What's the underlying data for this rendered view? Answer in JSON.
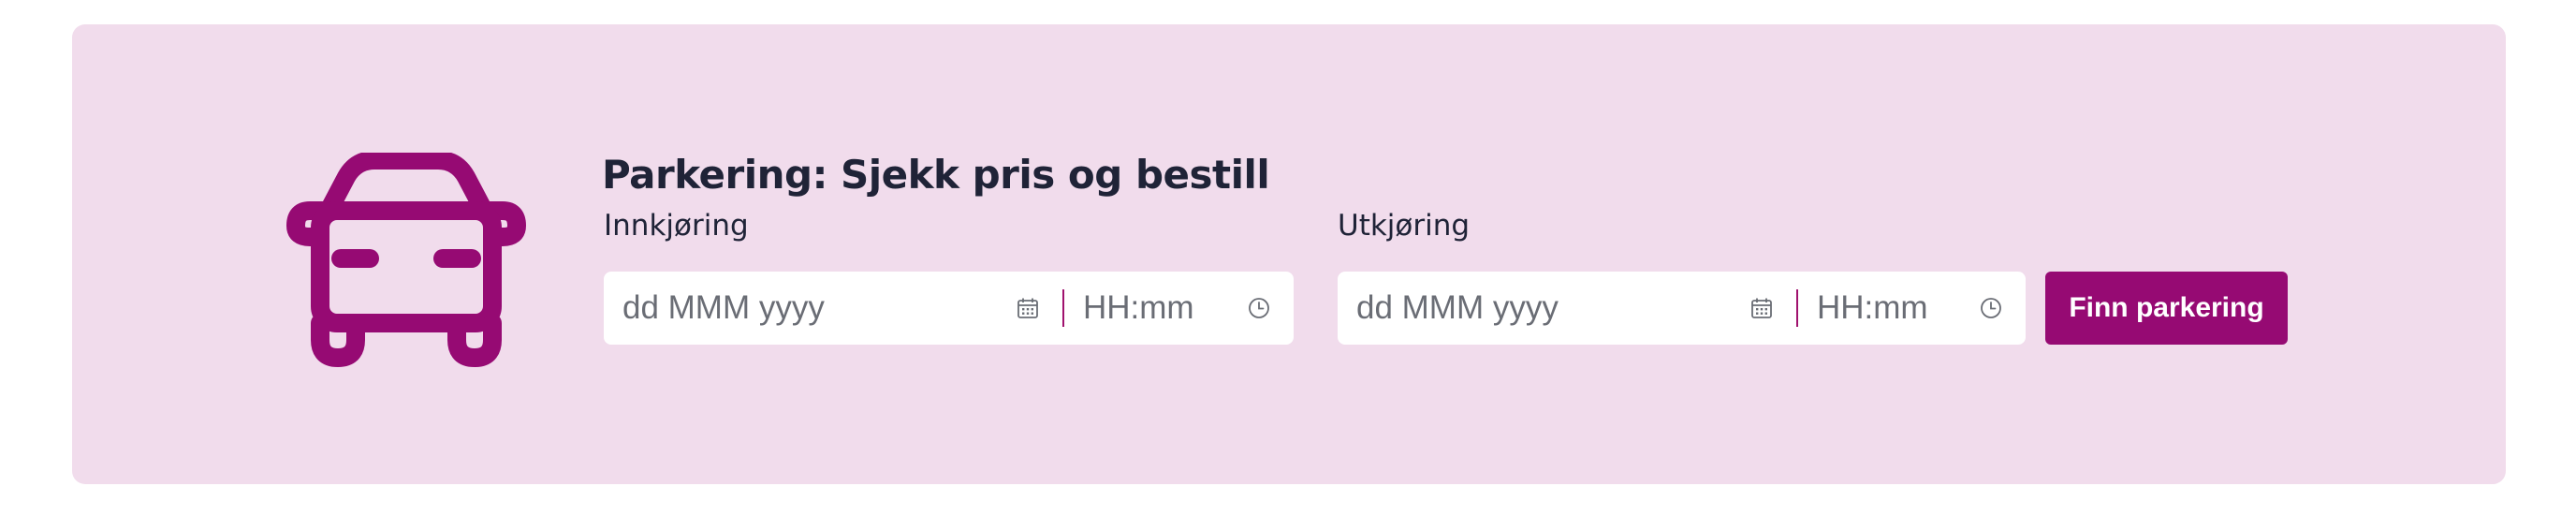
{
  "parking": {
    "title": "Parkering: Sjekk pris og bestill",
    "car_icon": "car-icon",
    "entry": {
      "label": "Innkjøring",
      "date_placeholder": "dd MMM yyyy",
      "time_placeholder": "HH:mm",
      "date_icon": "calendar-icon",
      "time_icon": "clock-icon"
    },
    "exit": {
      "label": "Utkjøring",
      "date_placeholder": "dd MMM yyyy",
      "time_placeholder": "HH:mm",
      "date_icon": "calendar-icon",
      "time_icon": "clock-icon"
    },
    "submit_label": "Finn parkering"
  },
  "colors": {
    "panel_background": "#f1dcec",
    "accent": "#960a73",
    "heading_text": "#1f2337",
    "placeholder_text": "#6a6d75"
  }
}
